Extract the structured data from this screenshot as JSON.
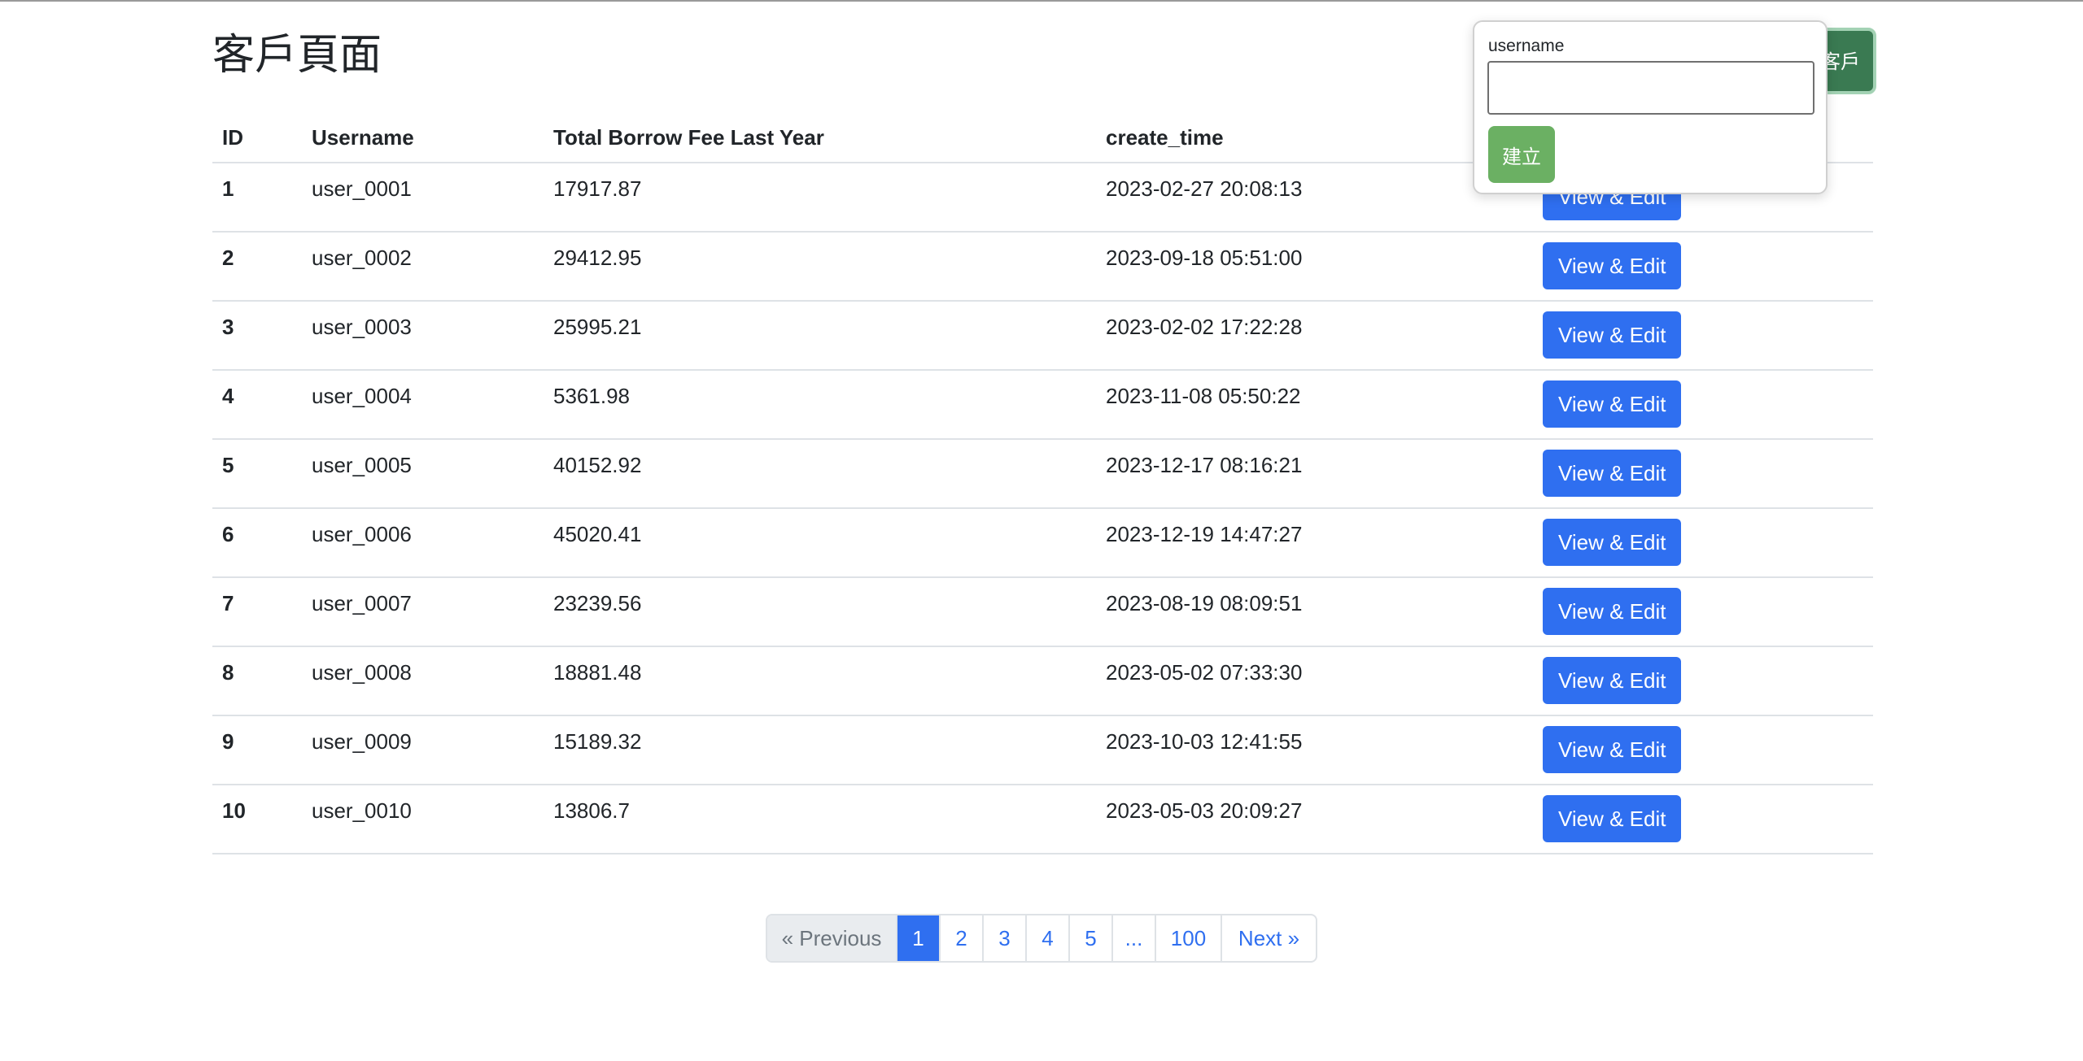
{
  "header": {
    "title": "客戶頁面",
    "add_button_label": "新增客戶"
  },
  "table": {
    "columns": [
      "ID",
      "Username",
      "Total Borrow Fee Last Year",
      "create_time",
      ""
    ],
    "action_label": "View & Edit",
    "rows": [
      {
        "id": "1",
        "username": "user_0001",
        "fee": "17917.87",
        "time": "2023-02-27 20:08:13"
      },
      {
        "id": "2",
        "username": "user_0002",
        "fee": "29412.95",
        "time": "2023-09-18 05:51:00"
      },
      {
        "id": "3",
        "username": "user_0003",
        "fee": "25995.21",
        "time": "2023-02-02 17:22:28"
      },
      {
        "id": "4",
        "username": "user_0004",
        "fee": "5361.98",
        "time": "2023-11-08 05:50:22"
      },
      {
        "id": "5",
        "username": "user_0005",
        "fee": "40152.92",
        "time": "2023-12-17 08:16:21"
      },
      {
        "id": "6",
        "username": "user_0006",
        "fee": "45020.41",
        "time": "2023-12-19 14:47:27"
      },
      {
        "id": "7",
        "username": "user_0007",
        "fee": "23239.56",
        "time": "2023-08-19 08:09:51"
      },
      {
        "id": "8",
        "username": "user_0008",
        "fee": "18881.48",
        "time": "2023-05-02 07:33:30"
      },
      {
        "id": "9",
        "username": "user_0009",
        "fee": "15189.32",
        "time": "2023-10-03 12:41:55"
      },
      {
        "id": "10",
        "username": "user_0010",
        "fee": "13806.7",
        "time": "2023-05-03 20:09:27"
      }
    ]
  },
  "popover": {
    "field_label": "username",
    "field_value": "",
    "submit_label": "建立"
  },
  "pagination": {
    "items": [
      {
        "label": "« Previous",
        "state": "disabled"
      },
      {
        "label": "1",
        "state": "active"
      },
      {
        "label": "2",
        "state": "normal"
      },
      {
        "label": "3",
        "state": "normal"
      },
      {
        "label": "4",
        "state": "normal"
      },
      {
        "label": "5",
        "state": "normal"
      },
      {
        "label": "...",
        "state": "normal"
      },
      {
        "label": "100",
        "state": "normal"
      },
      {
        "label": "Next »",
        "state": "normal"
      }
    ]
  },
  "colors": {
    "primary": "#2f6ff0",
    "success_dark": "#3a7a52",
    "success_light": "#6bb063",
    "border": "#dee2e6"
  }
}
